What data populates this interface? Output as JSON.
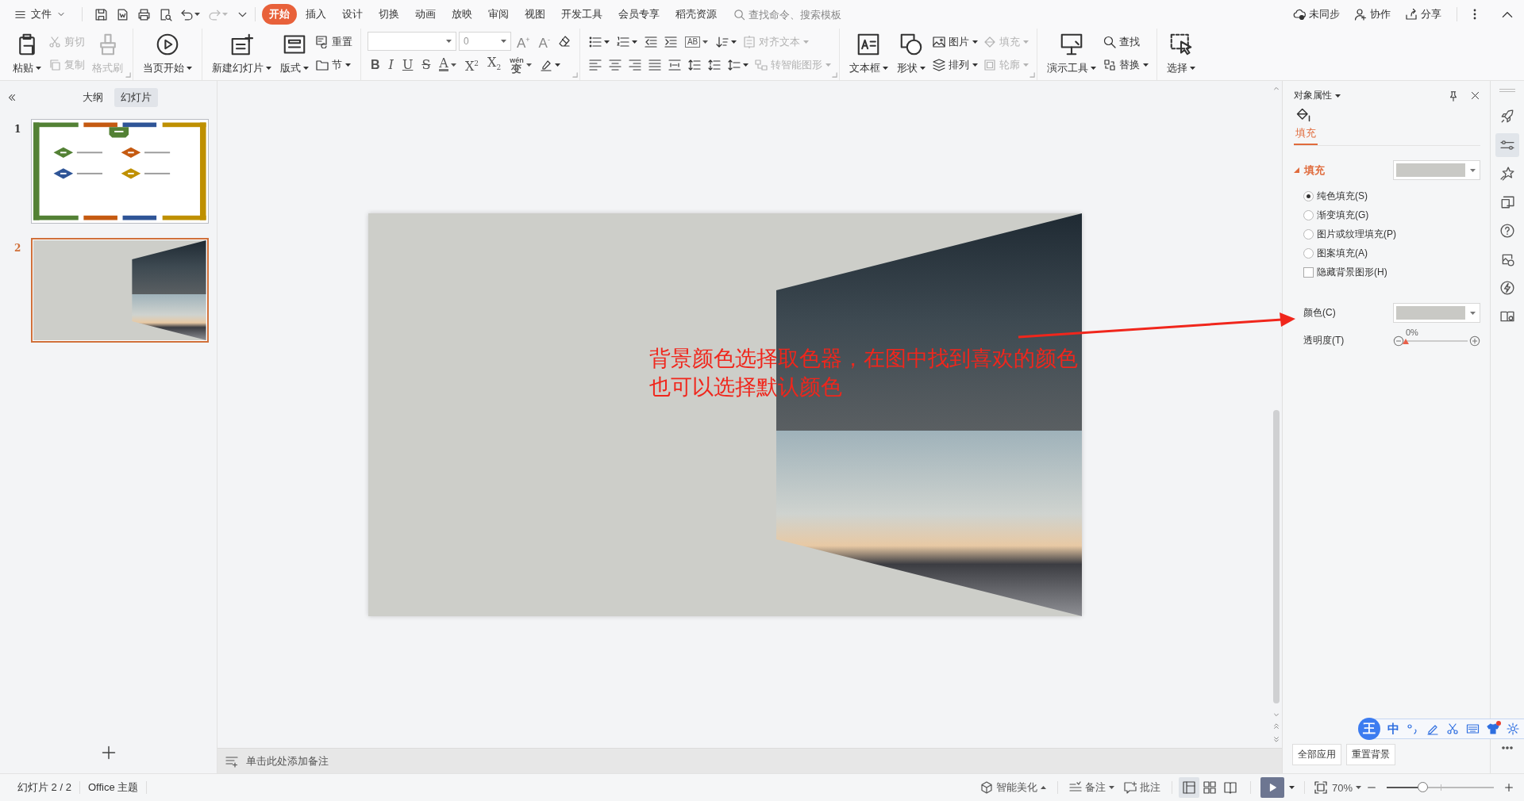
{
  "menu_bar": {
    "file_menu": "文件",
    "quick_access": [
      {
        "caret": false,
        "disabled": false
      },
      {
        "caret": false,
        "disabled": false
      },
      {
        "caret": false,
        "disabled": false
      },
      {
        "caret": false,
        "disabled": false
      },
      {
        "caret": true,
        "disabled": false
      },
      {
        "caret": true,
        "disabled": true
      },
      {
        "caret": false,
        "disabled": false
      }
    ],
    "tabs": [
      {
        "label": "开始",
        "selected": true
      },
      {
        "label": "插入",
        "selected": false
      },
      {
        "label": "设计",
        "selected": false
      },
      {
        "label": "切换",
        "selected": false
      },
      {
        "label": "动画",
        "selected": false
      },
      {
        "label": "放映",
        "selected": false
      },
      {
        "label": "审阅",
        "selected": false
      },
      {
        "label": "视图",
        "selected": false
      },
      {
        "label": "开发工具",
        "selected": false
      },
      {
        "label": "会员专享",
        "selected": false
      },
      {
        "label": "稻壳资源",
        "selected": false
      }
    ],
    "search": {
      "placeholder": "查找命令、搜索模板"
    },
    "actions": [
      {
        "label": "未同步"
      },
      {
        "label": "协作"
      },
      {
        "label": "分享"
      }
    ]
  },
  "ribbon": [
    {
      "launcher": true,
      "columns": [
        {
          "kind": "large",
          "label": "粘贴",
          "caret": true,
          "disabled": false
        },
        {
          "kind": "stack",
          "upper": [
            {
              "kind": "small",
              "label": "剪切",
              "caret": false,
              "disabled": true
            }
          ],
          "lower": [
            {
              "kind": "small",
              "label": "复制",
              "caret": false,
              "disabled": true
            }
          ]
        },
        {
          "kind": "large",
          "label": "格式刷",
          "caret": false,
          "disabled": true
        }
      ]
    },
    {
      "launcher": false,
      "columns": [
        {
          "kind": "large",
          "label": "当页开始",
          "caret": true,
          "disabled": false
        }
      ]
    },
    {
      "launcher": false,
      "columns": [
        {
          "kind": "large",
          "label": "新建幻灯片",
          "caret": true,
          "disabled": false
        },
        {
          "kind": "large",
          "label": "版式",
          "caret": true,
          "disabled": false
        },
        {
          "kind": "stack",
          "upper": [
            {
              "kind": "small",
              "label": "重置",
              "caret": false,
              "disabled": false
            }
          ],
          "lower": [
            {
              "kind": "small",
              "label": "节",
              "caret": true,
              "disabled": false
            }
          ]
        }
      ]
    },
    {
      "launcher": true,
      "columns": [
        {
          "kind": "stack",
          "upper": [
            {
              "kind": "select"
            },
            {
              "kind": "select",
              "value": "0"
            },
            {
              "kind": "glyph",
              "glyph": "A$^{+}$",
              "caret": false,
              "disabled": false
            },
            {
              "kind": "glyph",
              "glyph": "A$^{-}$",
              "caret": false,
              "disabled": false
            },
            {
              "kind": "icon",
              "caret": false,
              "disabled": false
            }
          ],
          "lower": [
            {
              "kind": "glyph",
              "glyph": "B",
              "caret": false,
              "disabled": false
            },
            {
              "kind": "glyph",
              "glyph": "I",
              "caret": false,
              "disabled": false
            },
            {
              "kind": "glyph",
              "glyph": "U",
              "caret": false,
              "disabled": false
            },
            {
              "kind": "glyph",
              "glyph": "S",
              "caret": false,
              "disabled": false
            },
            {
              "kind": "glyph",
              "glyph": "A",
              "caret": true,
              "disabled": false
            },
            {
              "kind": "glyph",
              "glyph": "X$^{2}$",
              "caret": false,
              "disabled": false
            },
            {
              "kind": "glyph",
              "glyph": "X$_{2}$",
              "caret": false,
              "disabled": false
            },
            {
              "kind": "glyph",
              "glyph": "变",
              "ruby": "wén",
              "caret": true,
              "disabled": false
            },
            {
              "kind": "icon",
              "caret": true,
              "disabled": false
            }
          ]
        }
      ]
    },
    {
      "launcher": true,
      "columns": [
        {
          "kind": "stack",
          "upper": [
            {
              "kind": "icon",
              "caret": true,
              "disabled": false
            },
            {
              "kind": "icon",
              "caret": true,
              "disabled": false
            },
            {
              "kind": "icon",
              "caret": false,
              "disabled": false
            },
            {
              "kind": "icon",
              "caret": false,
              "disabled": false
            },
            {
              "kind": "glyph",
              "glyph": "AB",
              "caret": true,
              "disabled": false
            },
            {
              "kind": "icon",
              "caret": true,
              "disabled": false
            },
            {
              "kind": "small",
              "label": "对齐文本",
              "caret": true,
              "disabled": true
            }
          ],
          "lower": [
            {
              "kind": "icon",
              "caret": false,
              "disabled": false
            },
            {
              "kind": "icon",
              "caret": false,
              "disabled": false
            },
            {
              "kind": "icon",
              "caret": false,
              "disabled": false
            },
            {
              "kind": "icon",
              "caret": false,
              "disabled": false
            },
            {
              "kind": "icon",
              "caret": false,
              "disabled": false
            },
            {
              "kind": "icon",
              "caret": false,
              "disabled": false
            },
            {
              "kind": "icon",
              "caret": false,
              "disabled": false
            },
            {
              "kind": "icon",
              "caret": true,
              "disabled": false
            },
            {
              "kind": "small",
              "label": "转智能图形",
              "caret": true,
              "disabled": true
            }
          ]
        }
      ]
    },
    {
      "launcher": true,
      "columns": [
        {
          "kind": "large",
          "label": "文本框",
          "caret": true,
          "disabled": false
        },
        {
          "kind": "large",
          "label": "形状",
          "caret": true,
          "disabled": false
        },
        {
          "kind": "stack",
          "upper": [
            {
              "kind": "small",
              "label": "图片",
              "caret": true,
              "disabled": false
            }
          ],
          "lower": [
            {
              "kind": "small",
              "label": "排列",
              "caret": true,
              "disabled": false
            }
          ]
        },
        {
          "kind": "stack",
          "upper": [
            {
              "kind": "small",
              "label": "填充",
              "caret": true,
              "disabled": true
            }
          ],
          "lower": [
            {
              "kind": "small",
              "label": "轮廓",
              "caret": true,
              "disabled": true
            }
          ]
        }
      ]
    },
    {
      "launcher": false,
      "columns": [
        {
          "kind": "large",
          "label": "演示工具",
          "caret": true,
          "disabled": false
        },
        {
          "kind": "stack",
          "upper": [
            {
              "kind": "small",
              "label": "查找",
              "caret": false,
              "disabled": false
            }
          ],
          "lower": [
            {
              "kind": "small",
              "label": "替换",
              "caret": true,
              "disabled": false
            }
          ]
        }
      ]
    },
    {
      "launcher": false,
      "columns": [
        {
          "kind": "large",
          "label": "选择",
          "caret": true,
          "disabled": false
        }
      ]
    }
  ],
  "slides_panel": {
    "tabs": [
      {
        "label": "大纲",
        "selected": false
      },
      {
        "label": "幻灯片",
        "selected": true
      }
    ],
    "slides": [
      {
        "number": "1",
        "kind": "agenda",
        "selected": false
      },
      {
        "number": "2",
        "kind": "photo",
        "selected": true
      }
    ]
  },
  "slide": {
    "annotation": [
      "背景颜色选择取色器，在图中找到喜欢的颜色",
      "也可以选择默认颜色"
    ]
  },
  "notes": {
    "placeholder": "单击此处添加备注"
  },
  "properties": {
    "title": "对象属性",
    "tabs": [
      {
        "label": "填充",
        "selected": true
      }
    ],
    "fill": {
      "label": "填充",
      "expanded": true,
      "options": [
        {
          "kind": "radio",
          "label": "纯色填充(S)",
          "checked": true
        },
        {
          "kind": "radio",
          "label": "渐变填充(G)",
          "checked": false
        },
        {
          "kind": "radio",
          "label": "图片或纹理填充(P)",
          "checked": false
        },
        {
          "kind": "radio",
          "label": "图案填充(A)",
          "checked": false
        },
        {
          "kind": "checkbox",
          "label": "隐藏背景图形(H)",
          "checked": false
        }
      ]
    },
    "color": {
      "label": "颜色(C)"
    },
    "transparency": {
      "label": "透明度(T)",
      "reading": "0%",
      "level": 0
    },
    "buttons": [
      "全部应用",
      "重置背景"
    ]
  },
  "icon_rail": [
    {
      "selected": false
    },
    {
      "selected": true
    },
    {
      "selected": false
    },
    {
      "selected": false
    },
    {
      "selected": false
    },
    {
      "selected": false
    },
    {
      "selected": false
    },
    {
      "selected": false
    }
  ],
  "ime_toolbar": {
    "logo": "王",
    "mode": "中"
  },
  "status_bar": {
    "slide_counter": "幻灯片 2 / 2",
    "theme": "Office 主题",
    "beautify": "智能美化",
    "notes": "备注",
    "comments": "批注",
    "views": [
      {
        "selected": true
      },
      {
        "selected": false
      },
      {
        "selected": false
      }
    ],
    "zoom": "70%",
    "zoom_slider": {
      "level": 0.33
    }
  }
}
